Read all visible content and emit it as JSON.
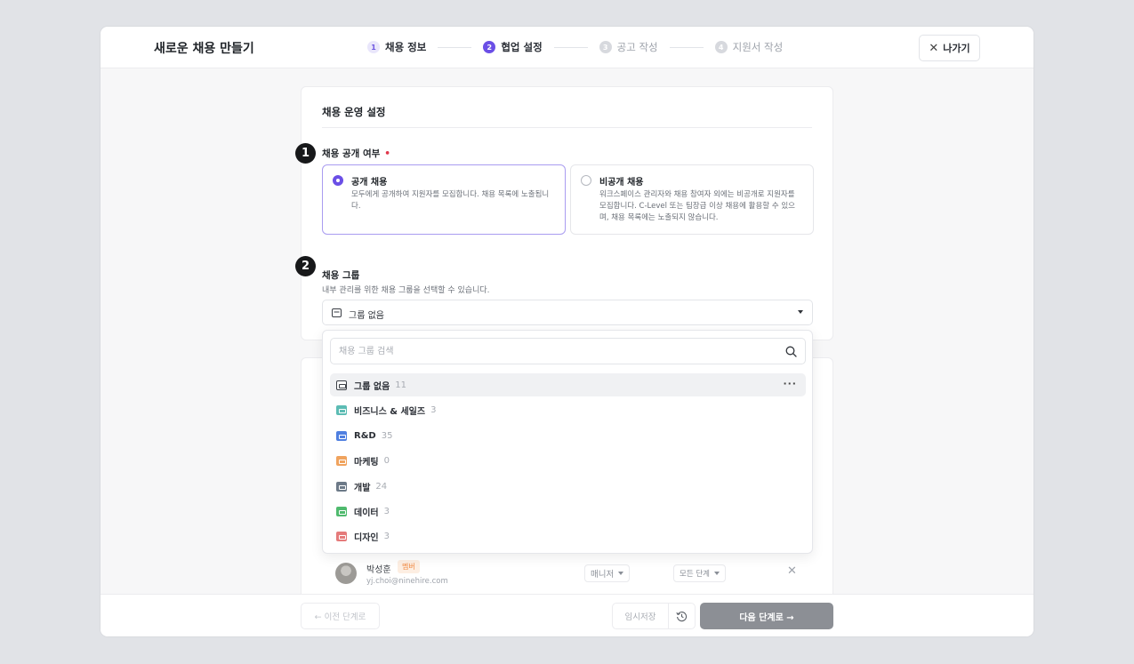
{
  "header": {
    "title": "새로운 채용 만들기",
    "exit_label": "나가기",
    "steps": [
      {
        "num": "1",
        "label": "채용 정보"
      },
      {
        "num": "2",
        "label": "협업 설정"
      },
      {
        "num": "3",
        "label": "공고 작성"
      },
      {
        "num": "4",
        "label": "지원서 작성"
      }
    ]
  },
  "settings": {
    "title": "채용 운영 설정",
    "visibility": {
      "marker": "1",
      "label": "채용 공개 여부",
      "required": "•",
      "options": [
        {
          "title": "공개 채용",
          "desc": "모두에게 공개하여 지원자를 모집합니다. 채용 목록에 노출됩니다."
        },
        {
          "title": "비공개 채용",
          "desc": "워크스페이스 관리자와 채용 참여자 외에는 비공개로 지원자를 모집합니다. C-Level 또는 팀장급 이상 채용에 활용할 수 있으며, 채용 목록에는 노출되지 않습니다."
        }
      ]
    },
    "group": {
      "marker": "2",
      "label": "채용 그룹",
      "help": "내부 관리를 위한 채용 그룹을 선택할 수 있습니다.",
      "selected": "그룹 없음"
    }
  },
  "dropdown": {
    "search_placeholder": "채용 그룹 검색",
    "items": [
      {
        "name": "그룹 없음",
        "count": "11",
        "color": "#ffffff"
      },
      {
        "name": "비즈니스 & 세일즈",
        "count": "3",
        "color": "#5cbcb4"
      },
      {
        "name": "R&D",
        "count": "35",
        "color": "#4f7fe0"
      },
      {
        "name": "마케팅",
        "count": "0",
        "color": "#f0a35e"
      },
      {
        "name": "개발",
        "count": "24",
        "color": "#6d7a88"
      },
      {
        "name": "데이터",
        "count": "3",
        "color": "#4fba6e"
      },
      {
        "name": "디자인",
        "count": "3",
        "color": "#e57b7b"
      }
    ]
  },
  "member": {
    "name": "박성훈",
    "badge": "멤버",
    "email": "yj.choi@ninehire.com",
    "role": "매니저",
    "stage": "모든 단계"
  },
  "footer": {
    "prev_label": "← 이전 단계로",
    "draft_label": "임시저장",
    "next_label": "다음 단계로 →"
  }
}
